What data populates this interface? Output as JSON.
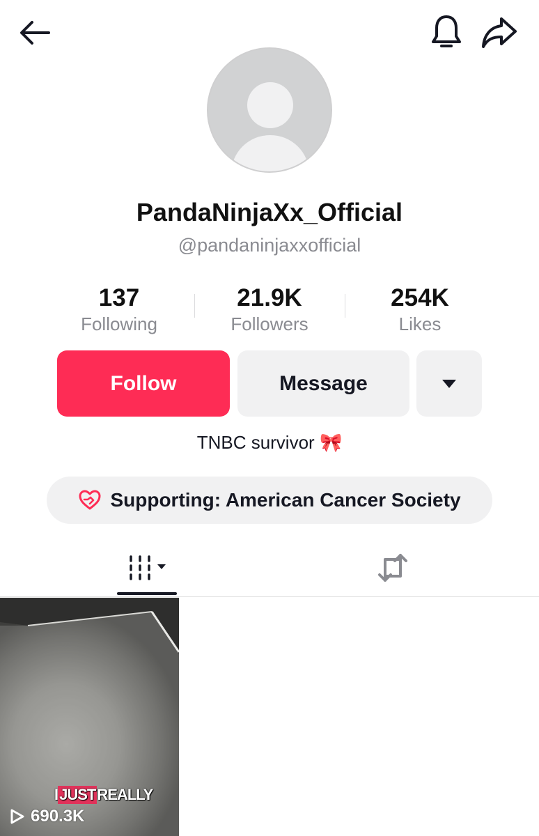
{
  "header": {
    "back_icon": "back-arrow-icon",
    "bell_icon": "bell-icon",
    "share_icon": "share-icon"
  },
  "profile": {
    "display_name": "PandaNinjaXx_Official",
    "username": "@pandaninjaxxofficial",
    "bio_text": "TNBC survivor",
    "bio_emoji": "🎀"
  },
  "stats": [
    {
      "value": "137",
      "label": "Following"
    },
    {
      "value": "21.9K",
      "label": "Followers"
    },
    {
      "value": "254K",
      "label": "Likes"
    }
  ],
  "actions": {
    "follow_label": "Follow",
    "message_label": "Message",
    "follow_color": "#fe2c55"
  },
  "supporting": {
    "text": "Supporting: American Cancer Society",
    "icon": "heart-hands-icon",
    "icon_color": "#fe2c55"
  },
  "tabs": [
    {
      "name": "videos",
      "icon": "grid-icon",
      "active": true
    },
    {
      "name": "reposts",
      "icon": "repost-icon",
      "active": false
    }
  ],
  "videos": [
    {
      "caption_plain": "I ",
      "caption_highlight": "JUST",
      "caption_rest": " REALLY",
      "views": "690.3K"
    }
  ]
}
